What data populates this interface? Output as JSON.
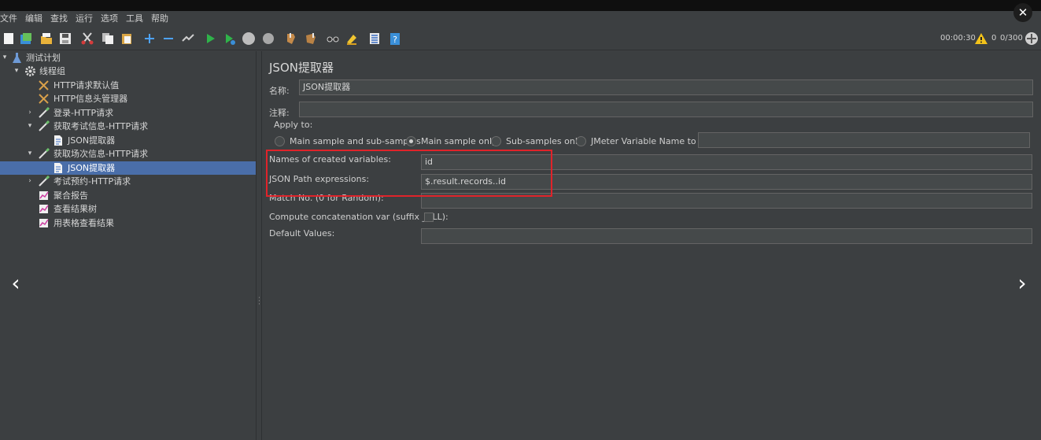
{
  "menu": [
    "文件",
    "编辑",
    "查找",
    "运行",
    "选项",
    "工具",
    "帮助"
  ],
  "overlay": {
    "close_glyph": "✕",
    "prev_glyph": "‹",
    "next_glyph": "›"
  },
  "toolbar": {
    "icons": [
      "new-icon",
      "templates-icon",
      "open-icon",
      "save-icon",
      "cut-icon",
      "copy-icon",
      "paste-icon",
      "expand-icon",
      "collapse-icon",
      "toggle-icon",
      "start-icon",
      "start-no-pause-icon",
      "stop-icon",
      "shutdown-icon",
      "clear-icon",
      "clear-all-icon",
      "search-icon",
      "reset-search-icon",
      "function-helper-icon",
      "help-icon"
    ]
  },
  "status": {
    "elapsed": "00:00:30",
    "warnings": "0",
    "threads": "0/300"
  },
  "tree": {
    "items": [
      {
        "label": "测试计划",
        "icon": "test-plan-icon",
        "twisty": "▾"
      },
      {
        "label": "线程组",
        "icon": "gear-icon",
        "twisty": "▾"
      },
      {
        "label": "HTTP请求默认值",
        "icon": "wrench-icon",
        "twisty": ""
      },
      {
        "label": "HTTP信息头管理器",
        "icon": "wrench-icon",
        "twisty": ""
      },
      {
        "label": "登录-HTTP请求",
        "icon": "pipette-icon",
        "twisty": "›"
      },
      {
        "label": "获取考试信息-HTTP请求",
        "icon": "pipette-icon",
        "twisty": "▾"
      },
      {
        "label": "JSON提取器",
        "icon": "document-icon",
        "twisty": ""
      },
      {
        "label": "获取场次信息-HTTP请求",
        "icon": "pipette-icon",
        "twisty": "▾"
      },
      {
        "label": "JSON提取器",
        "icon": "document-icon",
        "twisty": ""
      },
      {
        "label": "考试预约-HTTP请求",
        "icon": "pipette-icon",
        "twisty": "›"
      },
      {
        "label": "聚合报告",
        "icon": "chart-icon",
        "twisty": ""
      },
      {
        "label": "查看结果树",
        "icon": "chart-icon",
        "twisty": ""
      },
      {
        "label": "用表格查看结果",
        "icon": "chart-icon",
        "twisty": ""
      }
    ]
  },
  "panel": {
    "title": "JSON提取器",
    "name_label": "名称:",
    "name_value": "JSON提取器",
    "comment_label": "注释:",
    "comment_value": "",
    "apply_to_label": "Apply to:",
    "apply_options": [
      {
        "label": "Main sample and sub-samples",
        "selected": false
      },
      {
        "label": "Main sample only",
        "selected": true
      },
      {
        "label": "Sub-samples only",
        "selected": false
      },
      {
        "label": "JMeter Variable Name to use",
        "selected": false
      }
    ],
    "jmeter_variable_value": "",
    "var_names_label": "Names of created variables:",
    "var_names_value": "id",
    "json_path_label": "JSON Path expressions:",
    "json_path_value": "$.result.records..id",
    "match_no_label": "Match No. (0 for Random):",
    "match_no_value": "",
    "concat_label": "Compute concatenation var (suffix _ALL):",
    "concat_checked": false,
    "default_values_label": "Default Values:",
    "default_values_value": ""
  },
  "colors": {
    "highlight": "#e0232a",
    "selection": "#4a6ea9",
    "background": "#3c3f41"
  }
}
